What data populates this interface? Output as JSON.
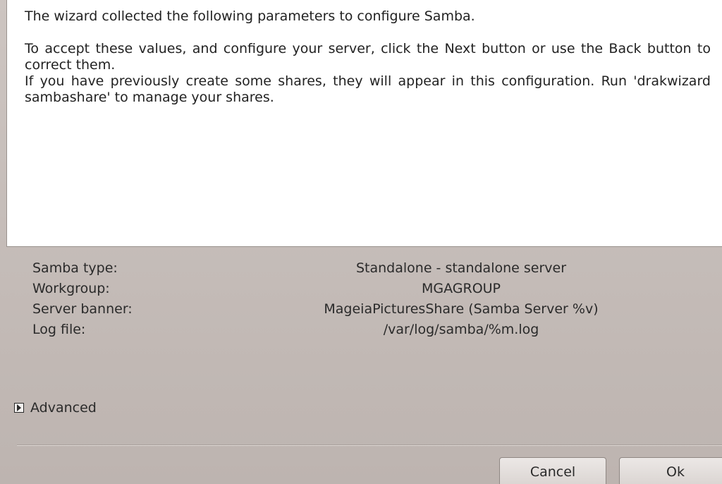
{
  "description": {
    "intro": "The wizard collected the following parameters to configure Samba.",
    "accept": "To accept these values, and configure your server, click the Next button or use the Back button to correct them.",
    "shares": "If you have previously create some shares, they will appear in this configuration. Run 'drakwizard sambashare' to manage your shares."
  },
  "parameters": [
    {
      "label": "Samba type:",
      "value": "Standalone - standalone server"
    },
    {
      "label": "Workgroup:",
      "value": "MGAGROUP"
    },
    {
      "label": "Server banner:",
      "value": "MageiaPicturesShare (Samba Server %v)"
    },
    {
      "label": "Log file:",
      "value": "/var/log/samba/%m.log"
    }
  ],
  "advanced": {
    "label": "Advanced",
    "expanded": false
  },
  "buttons": {
    "cancel": "Cancel",
    "ok": "Ok"
  }
}
